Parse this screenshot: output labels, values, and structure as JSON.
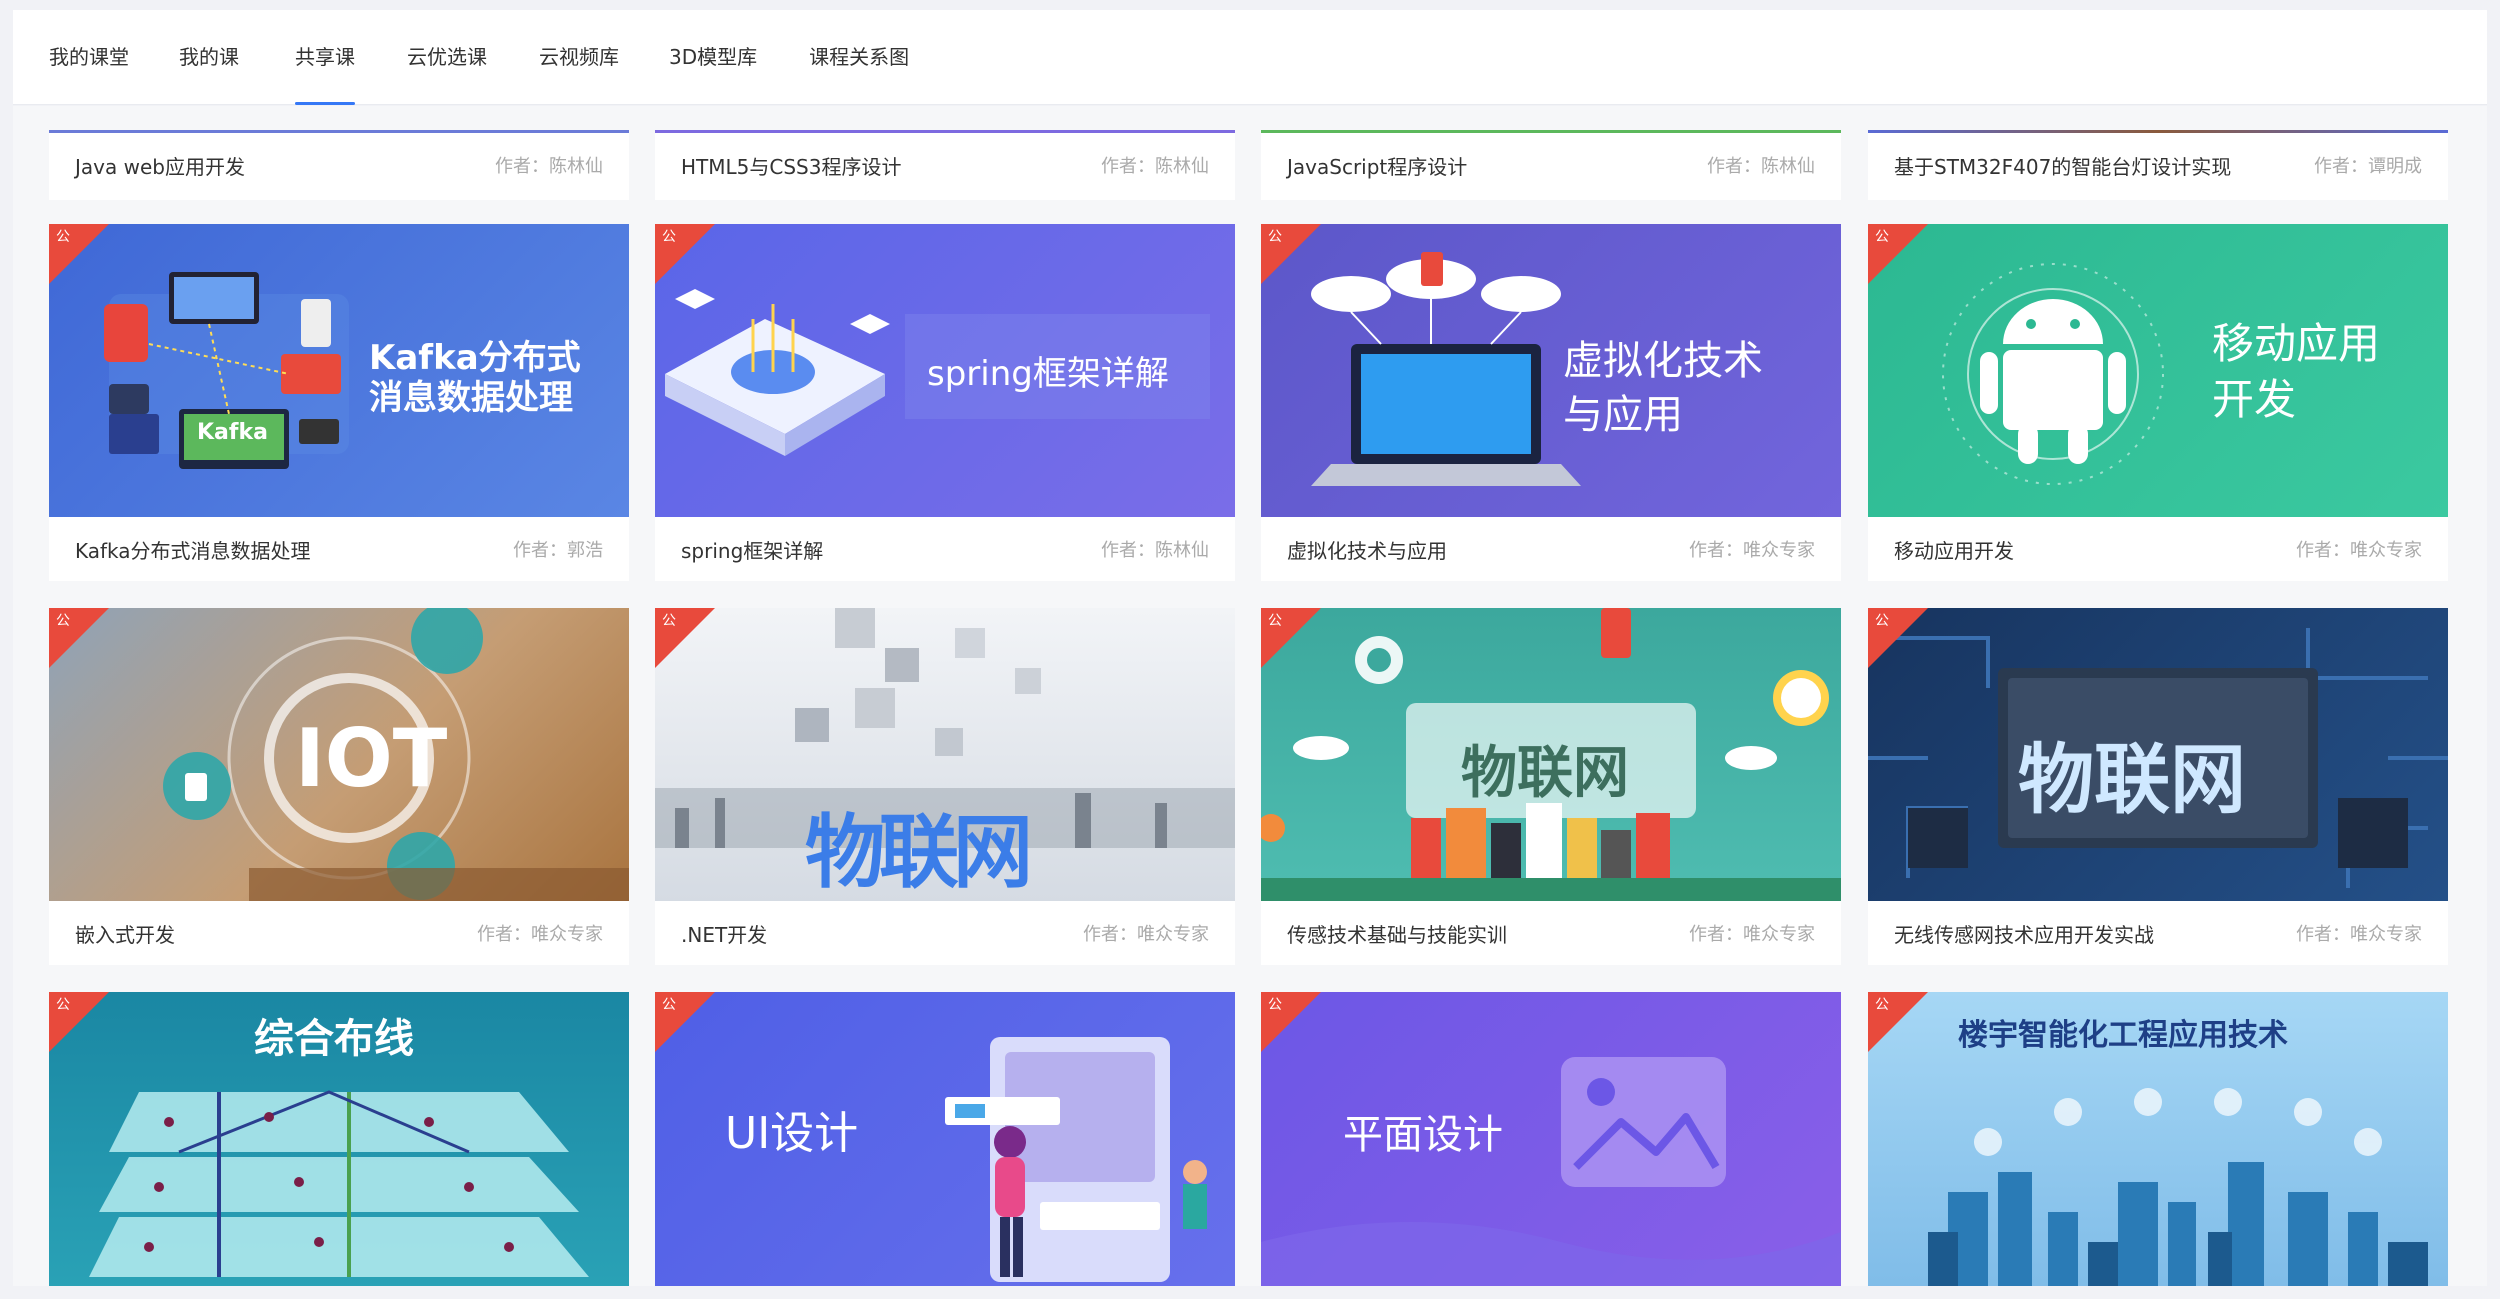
{
  "tabs": [
    {
      "label": "我的课堂",
      "active": false
    },
    {
      "label": "我的课",
      "active": false
    },
    {
      "label": "共享课",
      "active": true
    },
    {
      "label": "云优选课",
      "active": false
    },
    {
      "label": "云视频库",
      "active": false
    },
    {
      "label": "3D模型库",
      "active": false
    },
    {
      "label": "课程关系图",
      "active": false
    }
  ],
  "badge_label": "公",
  "row0": [
    {
      "title": "Java web应用开发",
      "author": "作者：陈林仙",
      "line": "#6b7bd8"
    },
    {
      "title": "HTML5与CSS3程序设计",
      "author": "作者：陈林仙",
      "line": "#7d6ae0"
    },
    {
      "title": "JavaScript程序设计",
      "author": "作者：陈林仙",
      "line": "#5cb85c"
    },
    {
      "title": "基于STM32F407的智能台灯设计实现",
      "author": "作者：谭明成",
      "line": "#5a6bd6"
    }
  ],
  "row1": [
    {
      "title": "Kafka分布式消息数据处理",
      "author": "作者：郭浩",
      "thumb": "Kafka分布式 消息数据处理",
      "thumb_l1": "Kafka分布式",
      "thumb_l2": "消息数据处理",
      "logo": "Kafka",
      "bg": "#4a72d8"
    },
    {
      "title": "spring框架详解",
      "author": "作者：陈林仙",
      "thumb": "spring框架详解",
      "bg": "#6a6fe6"
    },
    {
      "title": "虚拟化技术与应用",
      "author": "作者：唯众专家",
      "thumb_l1": "虚拟化技术",
      "thumb_l2": "与应用",
      "bg": "#6a5fd0"
    },
    {
      "title": "移动应用开发",
      "author": "作者：唯众专家",
      "thumb_l1": "移动应用",
      "thumb_l2": "开发",
      "bg": "#2fbf96"
    }
  ],
  "row2": [
    {
      "title": "嵌入式开发",
      "author": "作者：唯众专家",
      "thumb": "IOT",
      "bg": "#c9a27b"
    },
    {
      "title": ".NET开发",
      "author": "作者：唯众专家",
      "thumb": "物联网",
      "bg": "#dfe4ea"
    },
    {
      "title": "传感技术基础与技能实训",
      "author": "作者：唯众专家",
      "thumb": "物联网",
      "bg": "#41b1a6"
    },
    {
      "title": "无线传感网技术应用开发实战",
      "author": "作者：唯众专家",
      "thumb": "物联网",
      "bg": "#1c3e6e"
    }
  ],
  "row3": [
    {
      "thumb": "综合布线",
      "bg": "#1e8fa8"
    },
    {
      "thumb": "UI设计",
      "bg": "#5866e8"
    },
    {
      "thumb": "平面设计",
      "bg": "#7b5de6"
    },
    {
      "thumb": "楼宇智能化工程应用技术",
      "bg": "#8cc8ef"
    }
  ],
  "colors": {
    "accent": "#3578f6",
    "badge": "#e84a3c"
  }
}
